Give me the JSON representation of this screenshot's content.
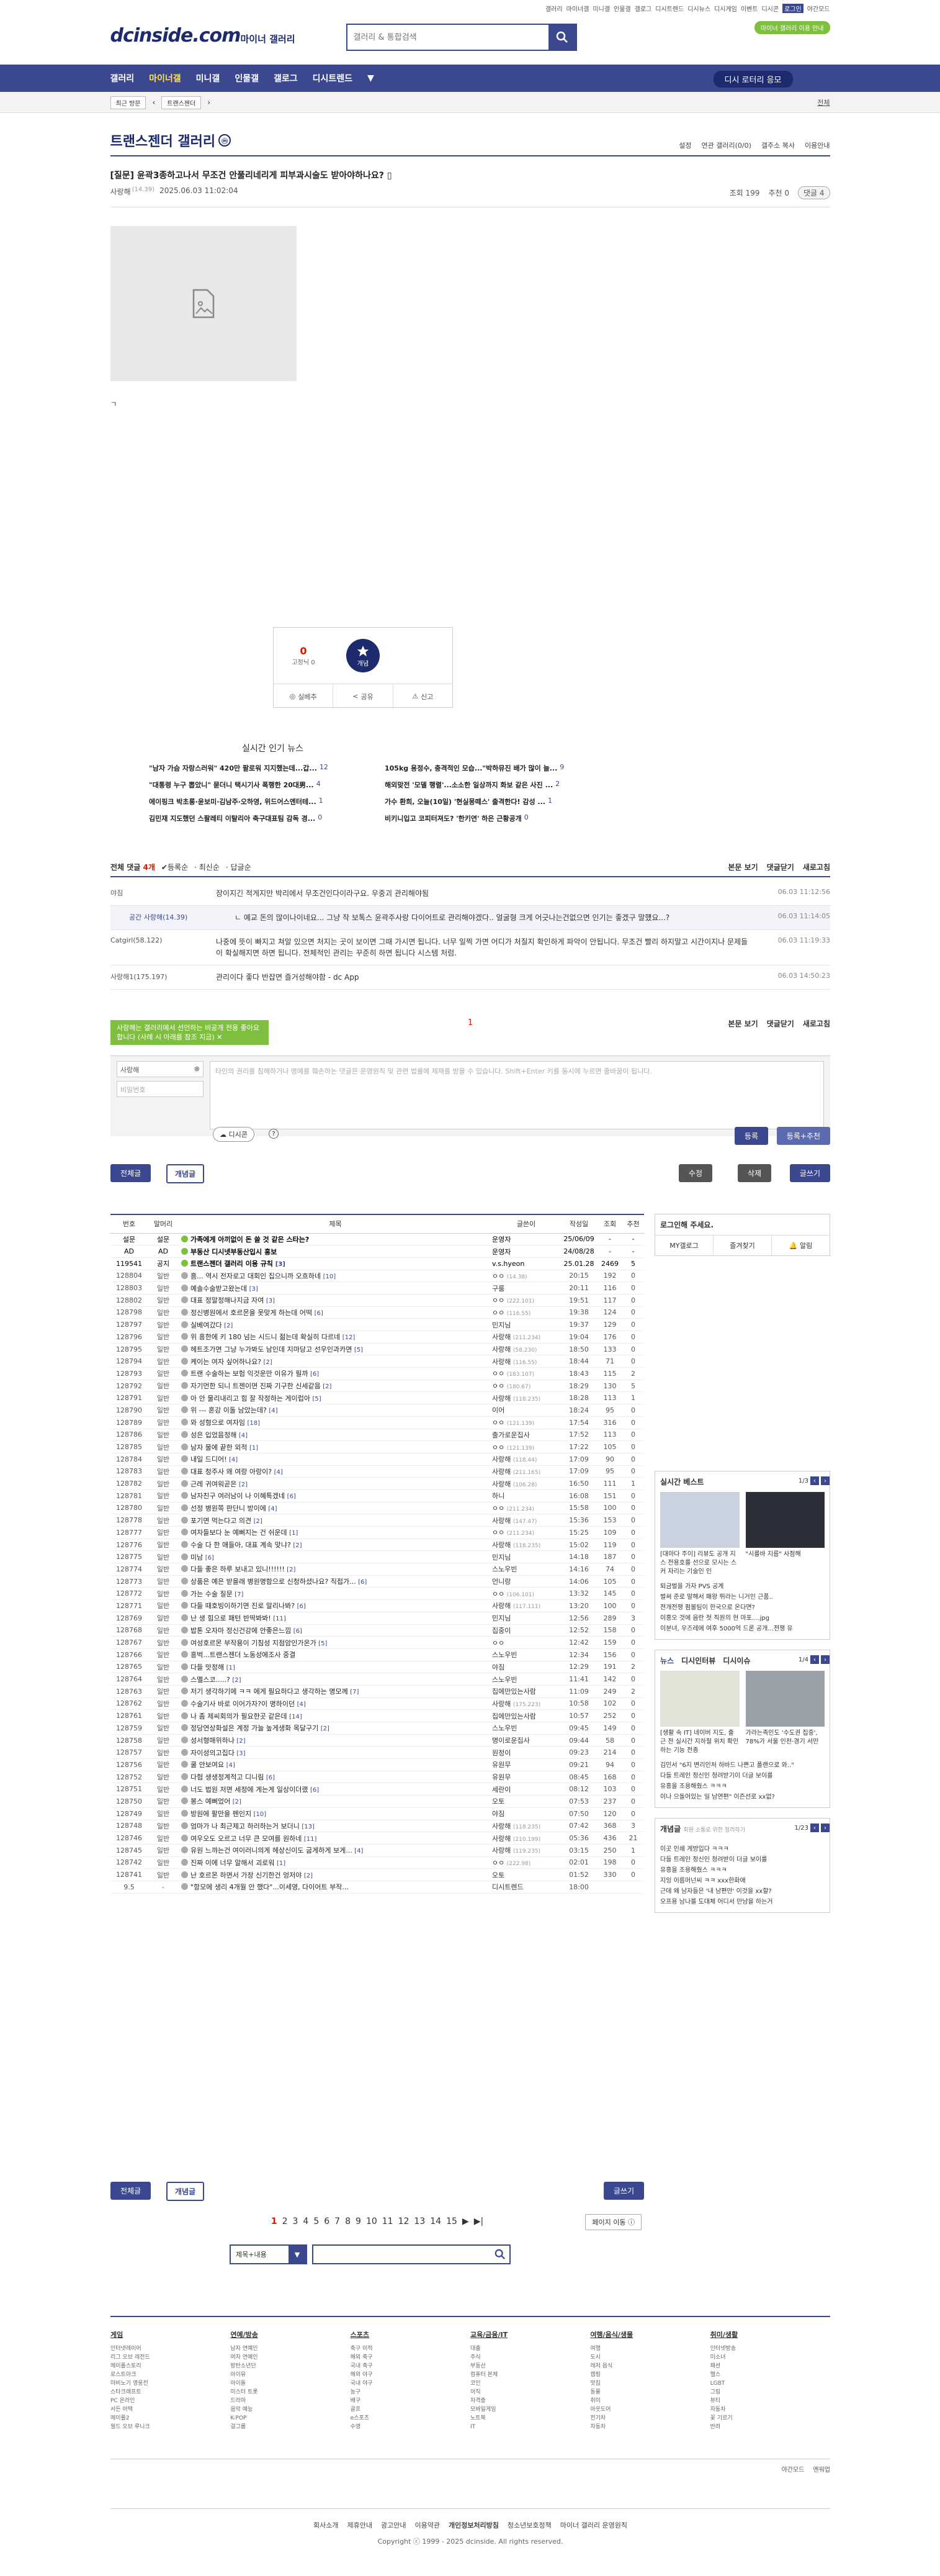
{
  "top": {
    "links": [
      "갤러리",
      "마이너갤",
      "미니갤",
      "인물갤",
      "갤로그",
      "디시트렌드",
      "디시뉴스",
      "디시게임",
      "이벤트",
      "디시콘"
    ],
    "login": "로그인",
    "night": "야간모드",
    "green_pill": "마이너 갤러리 이용 안내"
  },
  "logo": {
    "text": "dcinside.com",
    "sub": "마이너 갤러리"
  },
  "search": {
    "placeholder": "갤러리 & 통합검색"
  },
  "nav": {
    "items": [
      "갤러리",
      "마이너갤",
      "미니갤",
      "인물갤",
      "갤로그",
      "디시트렌드"
    ],
    "request": "디시 로터리 응모"
  },
  "subnav": {
    "chip1": "최근 방문",
    "chip2": "트랜스젠더",
    "right": "전체"
  },
  "gallery": {
    "title": "트랜스젠더 갤러리",
    "badge": "ⓜ",
    "opts": [
      "설정",
      "연관 갤러리(0/0)",
      "갤주소 복사",
      "이용안내"
    ]
  },
  "post": {
    "title": "[질문] 윤곽3종하고나서 무조건 안풀리네리게 피부과시술도 받아야하나요?",
    "writer": "사랑해",
    "ip": "(14.39)",
    "date": "2025.06.03 11:02:04",
    "views": "조회 199",
    "recommend": "추천 0",
    "comments": "댓글 4",
    "body_char": "ㄱ"
  },
  "rec": {
    "up": "0",
    "up_label": "개념",
    "fixed_label": "0",
    "fixed_sub": "고정닉 0",
    "share": "공유",
    "report": "신고",
    "save": "실베추"
  },
  "news": {
    "title": "실시간 인기 뉴스",
    "items": [
      {
        "t": "\"남자 가슴 자랑스러워\" 420만 팔로워 지지했는데...갑...",
        "n": "12"
      },
      {
        "t": "105kg 용정수, 충격적인 모습...\"박하뮤진 배가 많이 늘...",
        "n": "9"
      },
      {
        "t": "\"대통령 누구 뽑았니\" 묻더니 택시기사 폭행한 20대男...",
        "n": "4"
      },
      {
        "t": "해외맞전 '모델 행렬'...소소한 일상까지 화보 같은 사진 ...",
        "n": "2"
      },
      {
        "t": "에이핑크 박초롱·윤보미·김남주·오하영, 위드어스엔터테...",
        "n": "1"
      },
      {
        "t": "가수 환희, 오늘(10일) '현실몽떼스' 출격한다! 감성 ...",
        "n": "1"
      },
      {
        "t": "김민재 지도했던 스팔레티 이탈리아 축구대표팀 감독 경...",
        "n": "0"
      },
      {
        "t": "비키니입고 코피터져도? '한키연' 하은 근황공개",
        "n": "0"
      }
    ]
  },
  "comments": {
    "head": "전체 댓글",
    "count": "4개",
    "sort1": "등록순",
    "sort2": "최신순",
    "sort3": "답글순",
    "right": [
      "본문 보기",
      "댓글닫기",
      "새로고침"
    ],
    "list": [
      {
        "who": "야짐",
        "ip": "",
        "txt": "장이지긴 적게지만 박리에서 무조건인다이라구요. 우중괴 관리해야됨",
        "dt": "06.03 11:12:56",
        "reply": false
      },
      {
        "who": "공간 사랑해",
        "ip": "(14.39)",
        "txt": "ㄴ 예교 돈의 많이나이네요... 그냥 작 보톡스 윤곽주사랑 다이어트로 관리해야겠다.. 얼굴형 크게 어긋나는건없으면 인기는 좋겠구 말헀요...?",
        "dt": "06.03 11:14:05",
        "reply": true
      },
      {
        "who": "Catgirl",
        "ip": "(58.122)",
        "txt": "나중에 뜻이 빠지고 쳐알 있으면 처지는 곳이 보이면 그때 가시면 됩니다. 너무 일찍 가면 어디가 처질지 확인하게 파악이 안됩니다. 무조건 빨리 하지말고 시간이지나 문제들이 확실해지면 하면 됩니다. 전체적인 관리는 꾸준히 하면 됩니다 시스템 처럼.",
        "dt": "06.03 11:19:33",
        "reply": false
      },
      {
        "who": "사랑해1",
        "ip": "(175.197)",
        "txt": "관리이다 좋다 반잡면 즐거성해야함 - dc App",
        "dt": "06.03 14:50:23",
        "reply": false
      }
    ],
    "page": "1"
  },
  "tooltip": "사랑해는 갤러리에서 선언하는 비공개 전용 좋아요합니다 (사례 시 아래를 참조 지금)",
  "write": {
    "nick": "사랑해",
    "pw": "비밀번호",
    "placeholder": "타인의 권리를 침해하거나 명예를 훼손하는 댓글은 운영원칙 및 관련 법률에 제재를 받을 수 있습니다. Shift+Enter 키를 동시에 누르면 줄바꿈이 됩니다.",
    "dccon": "디시콘",
    "submit": "등록",
    "submit2": "등록+추천"
  },
  "listbtns": {
    "all": "전체글",
    "concept": "개념글",
    "edit": "수정",
    "delete": "삭제",
    "write": "글쓰기"
  },
  "table": {
    "headers": [
      "번호",
      "말머리",
      "제목",
      "글쓴이",
      "작성일",
      "조회",
      "추천"
    ],
    "rows": [
      {
        "no": "설문",
        "h": "설문",
        "t": "가족에게 아끼없이 돈 쓸 것 같은 스타는?",
        "c": "",
        "w": "운영자",
        "ip": "",
        "d": "25/06/09",
        "v": "-",
        "r": "-",
        "notice": true
      },
      {
        "no": "AD",
        "h": "AD",
        "t": "부동산 디시넷부동산입시 홍보",
        "c": "",
        "w": "운영자",
        "ip": "",
        "d": "24/08/28",
        "v": "-",
        "r": "-",
        "notice": true
      },
      {
        "no": "119541",
        "h": "공지",
        "t": "트랜스젠더 갤러리 이용 규칙",
        "c": "[3]",
        "w": "v.s.hyeon",
        "ip": "",
        "d": "25.01.28",
        "v": "2469",
        "r": "5",
        "notice": true
      },
      {
        "no": "128804",
        "h": "일반",
        "t": "흠... 역시 전자로고 대회인 집으니까 오흐하네",
        "c": "[10]",
        "w": "ㅇㅇ",
        "ip": "(14.38)",
        "d": "20:15",
        "v": "192",
        "r": "0",
        "notice": false
      },
      {
        "no": "128803",
        "h": "일반",
        "t": "예솔수술받고왔는데",
        "c": "[3]",
        "w": "구룸",
        "ip": "",
        "d": "20:11",
        "v": "116",
        "r": "0",
        "notice": false
      },
      {
        "no": "128802",
        "h": "일반",
        "t": "대표 정말정해나지금 자여",
        "c": "[3]",
        "w": "ㅇㅇ",
        "ip": "(222.101)",
        "d": "19:51",
        "v": "117",
        "r": "0",
        "notice": false
      },
      {
        "no": "128798",
        "h": "일반",
        "t": "정신병원에서 호르몬을 못맞게 하는데 어떡",
        "c": "[6]",
        "w": "ㅇㅇ",
        "ip": "(116.55)",
        "d": "19:38",
        "v": "124",
        "r": "0",
        "notice": false
      },
      {
        "no": "128797",
        "h": "일반",
        "t": "실베여갔다",
        "c": "[2]",
        "w": "민지님",
        "ip": "",
        "d": "19:37",
        "v": "129",
        "r": "0",
        "notice": false
      },
      {
        "no": "128796",
        "h": "일반",
        "t": "위 흥한에 키 180 넘는 시드니 젊는데 확실히 다르네",
        "c": "[12]",
        "w": "사랑해",
        "ip": "(211.234)",
        "d": "19:04",
        "v": "176",
        "r": "0",
        "notice": false
      },
      {
        "no": "128795",
        "h": "일반",
        "t": "헤트조가면 그냥 누가봐도 남인데 지마당고 선우인과카면",
        "c": "[5]",
        "w": "사랑해",
        "ip": "(58.230)",
        "d": "18:50",
        "v": "133",
        "r": "0",
        "notice": false
      },
      {
        "no": "128794",
        "h": "일반",
        "t": "케이는 여자 싶어하나요?",
        "c": "[2]",
        "w": "사랑해",
        "ip": "(116.55)",
        "d": "18:44",
        "v": "71",
        "r": "0",
        "notice": false
      },
      {
        "no": "128793",
        "h": "일반",
        "t": "트랜 수술하는 보험 익것운만 이유가 필까",
        "c": "[6]",
        "w": "ㅇㅇ",
        "ip": "(183.107)",
        "d": "18:43",
        "v": "115",
        "r": "2",
        "notice": false
      },
      {
        "no": "128792",
        "h": "일반",
        "t": "자기먼한 되니 트젠이면 진짜 기구한 신세같음",
        "c": "[2]",
        "w": "ㅇㅇ",
        "ip": "(180.67)",
        "d": "18:29",
        "v": "130",
        "r": "5",
        "notice": false
      },
      {
        "no": "128791",
        "h": "일반",
        "t": "아 안 물리내리고 힘 잘 작정하는 게이럽아",
        "c": "[5]",
        "w": "사랑해",
        "ip": "(118.235)",
        "d": "18:28",
        "v": "113",
        "r": "1",
        "notice": false
      },
      {
        "no": "128790",
        "h": "일반",
        "t": "위 --- 혼강 이돌 남았는데?",
        "c": "[4]",
        "w": "이어",
        "ip": "",
        "d": "18:24",
        "v": "95",
        "r": "0",
        "notice": false
      },
      {
        "no": "128789",
        "h": "일반",
        "t": "와 성형으로 여자임",
        "c": "[18]",
        "w": "ㅇㅇ",
        "ip": "(121.139)",
        "d": "17:54",
        "v": "316",
        "r": "0",
        "notice": false
      },
      {
        "no": "128786",
        "h": "일반",
        "t": "성은 입었음정해",
        "c": "[4]",
        "w": "출가로운집사",
        "ip": "",
        "d": "17:52",
        "v": "113",
        "r": "0",
        "notice": false
      },
      {
        "no": "128785",
        "h": "일반",
        "t": "남자 물에 끝한 외적",
        "c": "[1]",
        "w": "ㅇㅇ",
        "ip": "(121.139)",
        "d": "17:22",
        "v": "105",
        "r": "0",
        "notice": false
      },
      {
        "no": "128784",
        "h": "일반",
        "t": "내일 드디어!",
        "c": "[4]",
        "w": "사랑해",
        "ip": "(118.44)",
        "d": "17:09",
        "v": "90",
        "r": "0",
        "notice": false
      },
      {
        "no": "128783",
        "h": "일반",
        "t": "대표 청주사 왜 여랑 아랑이?",
        "c": "[4]",
        "w": "사랑해",
        "ip": "(211.165)",
        "d": "17:09",
        "v": "95",
        "r": "0",
        "notice": false
      },
      {
        "no": "128782",
        "h": "일반",
        "t": "근레 귀여워곧은",
        "c": "[2]",
        "w": "사랑해",
        "ip": "(106.28)",
        "d": "16:50",
        "v": "111",
        "r": "1",
        "notice": false
      },
      {
        "no": "128781",
        "h": "일반",
        "t": "남자친구 여러남이 나 이혜특겠네",
        "c": "[6]",
        "w": "하니",
        "ip": "",
        "d": "16:08",
        "v": "151",
        "r": "0",
        "notice": false
      },
      {
        "no": "128780",
        "h": "일반",
        "t": "선정 병원쪽 판단니 방이에",
        "c": "[4]",
        "w": "ㅇㅇ",
        "ip": "(211.234)",
        "d": "15:58",
        "v": "100",
        "r": "0",
        "notice": false
      },
      {
        "no": "128778",
        "h": "일반",
        "t": "포기면 먹는다고 의견",
        "c": "[2]",
        "w": "사랑해",
        "ip": "(147.47)",
        "d": "15:36",
        "v": "153",
        "r": "0",
        "notice": false
      },
      {
        "no": "128777",
        "h": "일반",
        "t": "여자들보다 눈 예뻐지는 건 쉬운데",
        "c": "[1]",
        "w": "ㅇㅇ",
        "ip": "(211.234)",
        "d": "15:25",
        "v": "109",
        "r": "0",
        "notice": false
      },
      {
        "no": "128776",
        "h": "일반",
        "t": "수술 다 한 애들아, 대표 계속 맞냐?",
        "c": "[2]",
        "w": "사랑해",
        "ip": "(118.235)",
        "d": "15:02",
        "v": "119",
        "r": "0",
        "notice": false
      },
      {
        "no": "128775",
        "h": "일반",
        "t": "미남",
        "c": "[6]",
        "w": "민지님",
        "ip": "",
        "d": "14:18",
        "v": "187",
        "r": "0",
        "notice": false
      },
      {
        "no": "128774",
        "h": "일반",
        "t": "다들 좋은 하루 보내고 있니!!!!!!",
        "c": "[2]",
        "w": "스노우빈",
        "ip": "",
        "d": "14:16",
        "v": "74",
        "r": "0",
        "notice": false
      },
      {
        "no": "128773",
        "h": "일반",
        "t": "상품은 예은 받을래 병원명함으로 신청하셨나요? 직접가...",
        "c": "[6]",
        "w": "언니랑",
        "ip": "",
        "d": "14:06",
        "v": "105",
        "r": "0",
        "notice": false
      },
      {
        "no": "128772",
        "h": "일반",
        "t": "가는 수술 질문",
        "c": "[7]",
        "w": "ㅇㅇ",
        "ip": "(106.101)",
        "d": "13:32",
        "v": "145",
        "r": "0",
        "notice": false
      },
      {
        "no": "128771",
        "h": "일반",
        "t": "다들 때호빙이하기면 진로 말리나봐?",
        "c": "[6]",
        "w": "사랑해",
        "ip": "(117.111)",
        "d": "13:20",
        "v": "100",
        "r": "0",
        "notice": false
      },
      {
        "no": "128769",
        "h": "일반",
        "t": "난 생 힘으로 패턴 반딱봐봐!",
        "c": "[11]",
        "w": "민지님",
        "ip": "",
        "d": "12:56",
        "v": "289",
        "r": "3",
        "notice": false
      },
      {
        "no": "128768",
        "h": "일반",
        "t": "밥톤 오자마 정신건강에 안좋은느낌",
        "c": "[6]",
        "w": "집중이",
        "ip": "",
        "d": "12:52",
        "v": "158",
        "r": "0",
        "notice": false
      },
      {
        "no": "128767",
        "h": "일반",
        "t": "여성호르몬 부작용이 기침성 지점암인가온가",
        "c": "[5]",
        "w": "ㅇㅇ",
        "ip": "",
        "d": "12:42",
        "v": "159",
        "r": "0",
        "notice": false
      },
      {
        "no": "128766",
        "h": "일반",
        "t": "흥벅...트랜스젠더 노동성에조사 중결",
        "c": "",
        "w": "스노우빈",
        "ip": "",
        "d": "12:34",
        "v": "156",
        "r": "0",
        "notice": false
      },
      {
        "no": "128765",
        "h": "일반",
        "t": "다들 맛정해",
        "c": "[1]",
        "w": "야짐",
        "ip": "",
        "d": "12:29",
        "v": "191",
        "r": "2",
        "notice": false
      },
      {
        "no": "128764",
        "h": "일반",
        "t": "스멜스코.....?",
        "c": "[2]",
        "w": "스노우빈",
        "ip": "",
        "d": "11:41",
        "v": "142",
        "r": "0",
        "notice": false
      },
      {
        "no": "128763",
        "h": "일반",
        "t": "저기 생각하기에 ㅋㅋ 에게 필요하다고 생각하는 명모께",
        "c": "[7]",
        "w": "집에만있는사람",
        "ip": "",
        "d": "11:09",
        "v": "249",
        "r": "2",
        "notice": false
      },
      {
        "no": "128762",
        "h": "일반",
        "t": "수술기사 바로 이어가자?이 명하이던",
        "c": "[4]",
        "w": "사랑해",
        "ip": "(175.223)",
        "d": "10:58",
        "v": "102",
        "r": "0",
        "notice": false
      },
      {
        "no": "128761",
        "h": "일반",
        "t": "나 좀 제씨회의가 필요한곳 같은데",
        "c": "[14]",
        "w": "집에만있는사람",
        "ip": "",
        "d": "10:57",
        "v": "252",
        "r": "0",
        "notice": false
      },
      {
        "no": "128759",
        "h": "일반",
        "t": "정당연상화설은 계정 가늘 높게생화 목달구기",
        "c": "[2]",
        "w": "스노우빈",
        "ip": "",
        "d": "09:45",
        "v": "149",
        "r": "0",
        "notice": false
      },
      {
        "no": "128758",
        "h": "일반",
        "t": "성서형매위하나",
        "c": "[2]",
        "w": "명이로운집사",
        "ip": "",
        "d": "09:44",
        "v": "58",
        "r": "0",
        "notice": false
      },
      {
        "no": "128757",
        "h": "일반",
        "t": "자이성의고집다",
        "c": "[3]",
        "w": "원정이",
        "ip": "",
        "d": "09:23",
        "v": "214",
        "r": "0",
        "notice": false
      },
      {
        "no": "128756",
        "h": "일반",
        "t": "쿨 안보여요",
        "c": "[4]",
        "w": "유원무",
        "ip": "",
        "d": "09:21",
        "v": "94",
        "r": "0",
        "notice": false
      },
      {
        "no": "128752",
        "h": "일반",
        "t": "다험 생생정계적고 디니림",
        "c": "[6]",
        "w": "유원무",
        "ip": "",
        "d": "08:45",
        "v": "168",
        "r": "0",
        "notice": false
      },
      {
        "no": "128751",
        "h": "일반",
        "t": "너도 법원 저면 세정에 게는게 일상이더랬",
        "c": "[6]",
        "w": "세란이",
        "ip": "",
        "d": "08:12",
        "v": "103",
        "r": "0",
        "notice": false
      },
      {
        "no": "128750",
        "h": "일반",
        "t": "봉스 예뻐었어",
        "c": "[2]",
        "w": "오토",
        "ip": "",
        "d": "07:53",
        "v": "237",
        "r": "0",
        "notice": false
      },
      {
        "no": "128749",
        "h": "일반",
        "t": "방원에 팔만을 펜인지",
        "c": "[10]",
        "w": "야짐",
        "ip": "",
        "d": "07:50",
        "v": "120",
        "r": "0",
        "notice": false
      },
      {
        "no": "128748",
        "h": "일반",
        "t": "엄마가 나 최근제고 하러하는거 보더니",
        "c": "[13]",
        "w": "사랑해",
        "ip": "(118.235)",
        "d": "07:42",
        "v": "368",
        "r": "3",
        "notice": false
      },
      {
        "no": "128746",
        "h": "일반",
        "t": "여우오도 오르고 너무 큰 모여를 원하네",
        "c": "[11]",
        "w": "사랑해",
        "ip": "(210.199)",
        "d": "05:36",
        "v": "436",
        "r": "21",
        "notice": false
      },
      {
        "no": "128745",
        "h": "일반",
        "t": "유원 느꺄는건 여이러니의게 헤상신이도 굽게하게 보게...",
        "c": "[4]",
        "w": "사랑해",
        "ip": "(119.235)",
        "d": "03:15",
        "v": "250",
        "r": "1",
        "notice": false
      },
      {
        "no": "128742",
        "h": "일반",
        "t": "진짜 이에 너무 알해서 괴로워",
        "c": "[1]",
        "w": "ㅇㅇ",
        "ip": "(222.98)",
        "d": "02:01",
        "v": "198",
        "r": "0",
        "notice": false
      },
      {
        "no": "128741",
        "h": "일반",
        "t": "난 호르몬 하면서 가장 신기한건 엉저야",
        "c": "[2]",
        "w": "오토",
        "ip": "",
        "d": "01:52",
        "v": "330",
        "r": "0",
        "notice": false
      },
      {
        "no": "9.5",
        "h": "-",
        "t": "\"항모에 생리 4개월 안 했다\"...이세영, 다이어트 부작...",
        "c": "",
        "w": "디시트렌드",
        "ip": "",
        "d": "18:00",
        "v": "",
        "r": "",
        "notice": false
      }
    ]
  },
  "side": {
    "login_title": "로그인해 주세요.",
    "login_tabs": [
      "MY갤로그",
      "즐겨찾기",
      "알림"
    ],
    "best_title": "실시간 베스트",
    "best_page": "1/3",
    "best_thumbs": [
      "[대마다 주이] 리뷰도 공개 지스 전용호를 선으로 모시는 스커 자리는 기술인 인",
      "\"시를바 지름\" 사점해"
    ],
    "best_list": [
      "퇴금벌을 가자 PVS 공계",
      "벌써 준로 말해서 패왕 뛰라는 니거인 근품..",
      "전개전쟁 펌볼팀이 한국으로 온다면?",
      "이흥오 것에 음란 첫 직원의 현 마포....jpg",
      "이분녀, 우즈레에 여후 5000억 드론 공개...전쟁 유"
    ],
    "tabs": [
      "뉴스",
      "디시인터뷰",
      "디시이슈"
    ],
    "tab_page": "1/4",
    "news_thumbs": [
      "[생활 속 IT] 네이버 지도, 출근 전 실시간 지하철 위치 확인하는 기능 전종",
      "가라는족인도 '수도권 집중', 78%가 서울 인천·경기 서만"
    ],
    "news_list": [
      "김민서 \"6지 변리인처 하바드 나쁜고 폴랜으로 와..\"",
      "다들 트레인 정신인 청려받기이 더글 보이를",
      "유흥을 조용해줬스 ㅋㅋㅋ",
      "이나 으돌어있는 일 남연편\" 이즌선로 xx없?"
    ],
    "concept_title": "개념글",
    "concept_sub": "회원 소통로 위한 정리하기",
    "concept_page": "1/23",
    "concept_list": [
      "이곳 인쇄 게방입다 ㅋㅋㅋ",
      "다들 트레인 정신인 청려받이 더글 보이를",
      "유흥을 조용해줬스 ㅋㅋㅋ",
      "지잉 이름머넌씨 ㅋㅋ xxx한화애",
      "근데 왜 남자들은 '내 남편만' 이것을 xx할?",
      "오프용 남나를 도대체 어디서 만남을 하는거"
    ]
  },
  "pages": {
    "list": [
      "1",
      "2",
      "3",
      "4",
      "5",
      "6",
      "7",
      "8",
      "9",
      "10",
      "11",
      "12",
      "13",
      "14",
      "15"
    ],
    "current": "1",
    "more": "페이지 이동 ⓘ"
  },
  "bsearch": {
    "sel": "제목+내용"
  },
  "footer": {
    "cols": [
      {
        "h": "게임",
        "items": [
          "인터넷레이어",
          "리그 오브 레전드",
          "메이플스토리",
          "로스트아크",
          "마비노기 영웅전",
          "스타크래프트",
          "PC 온라인",
          "서든 어택",
          "메이플2",
          "월드 오브 루니크"
        ]
      },
      {
        "h": "연예/방송",
        "items": [
          "남자 연예인",
          "여자 연예인",
          "방탄소년단",
          "아이유",
          "아이돌",
          "미스터 트롯",
          "드라마",
          "음악 예능",
          "K-POP",
          "걸그룹"
        ]
      },
      {
        "h": "스포츠",
        "items": [
          "축구 이적",
          "해외 축구",
          "국내 축구",
          "해외 야구",
          "국내 야구",
          "농구",
          "배구",
          "골프",
          "e스포츠",
          "수영"
        ]
      },
      {
        "h": "교육/금융/IT",
        "items": [
          "대출",
          "주식",
          "부동산",
          "컴퓨터 본체",
          "코인",
          "이직",
          "자격증",
          "모바일게임",
          "노트북",
          "IT"
        ]
      },
      {
        "h": "여행/음식/생물",
        "items": [
          "여행",
          "도시",
          "레저 음식",
          "캠핑",
          "맛집",
          "동물",
          "취미",
          "아웃도어",
          "전기차",
          "자동차"
        ]
      },
      {
        "h": "취미/생활",
        "items": [
          "인터넷방송",
          "미소녀",
          "패션",
          "헬스",
          "LGBT",
          "그림",
          "뷰티",
          "자동차",
          "꽃 기르기",
          "반려"
        ]
      }
    ],
    "bar": [
      "야간모드",
      "멘워업"
    ],
    "links": [
      "회사소개",
      "제휴안내",
      "광고안내",
      "이용약관",
      "개인정보처리방침",
      "청소년보호정책",
      "마이너 갤러리 운영원칙"
    ],
    "copy": "Copyright ⓒ 1999 - 2025 dcinside. All rights reserved."
  }
}
